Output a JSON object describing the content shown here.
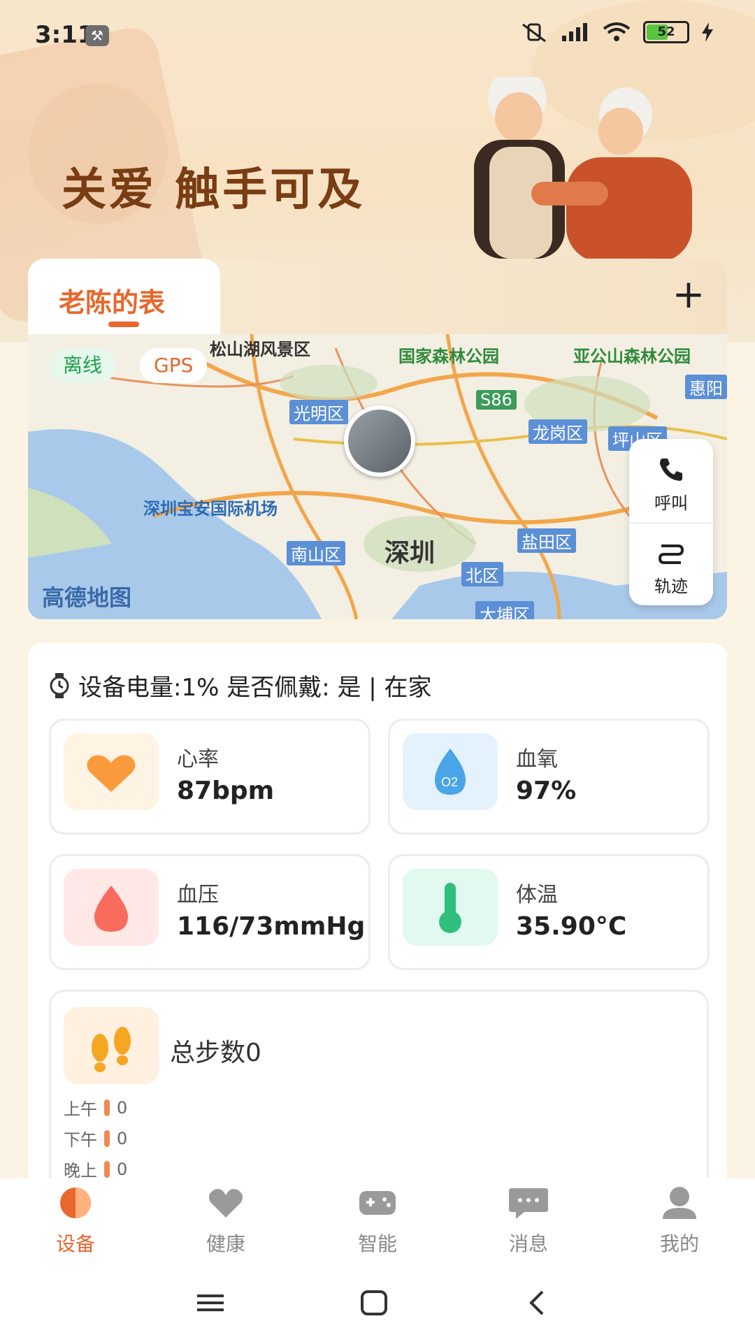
{
  "status_bar": {
    "time": "3:11",
    "battery": "52"
  },
  "banner": {
    "slogan": "关爱 触手可及"
  },
  "tabs": {
    "active_label": "老陈的表",
    "add_symbol": "+"
  },
  "map": {
    "offline_label": "离线",
    "gps_label": "GPS",
    "logo": "高德地图",
    "labels": {
      "guangming": "光明区",
      "longgang": "龙岗区",
      "pingshan": "坪山区",
      "airport": "深圳宝安国际机场",
      "nanshan": "南山区",
      "shenzhen": "深圳",
      "yantian": "盐田区",
      "futian": "北区",
      "forest": "国家森林公园",
      "yagong": "亚公山森林公园",
      "s86": "S86",
      "lake": "松山湖风景区",
      "dapeng": "大埔区",
      "huizhou": "惠阳"
    },
    "call_label": "呼叫",
    "track_label": "轨迹"
  },
  "device": {
    "status_text": "设备电量:1% 是否佩戴: 是 | 在家"
  },
  "metrics": {
    "heart_rate": {
      "name": "心率",
      "value": "87bpm"
    },
    "blood_oxygen": {
      "name": "血氧",
      "value": "97%"
    },
    "blood_pressure": {
      "name": "血压",
      "value": "116/73mmHg"
    },
    "temperature": {
      "name": "体温",
      "value": "35.90°C"
    }
  },
  "steps": {
    "title": "总步数0",
    "rows": [
      {
        "label": "上午",
        "value": "0"
      },
      {
        "label": "下午",
        "value": "0"
      },
      {
        "label": "晚上",
        "value": "0"
      }
    ]
  },
  "nav": [
    {
      "label": "设备",
      "icon": "device-icon"
    },
    {
      "label": "健康",
      "icon": "heart-icon"
    },
    {
      "label": "智能",
      "icon": "gamepad-icon"
    },
    {
      "label": "消息",
      "icon": "message-icon"
    },
    {
      "label": "我的",
      "icon": "profile-icon"
    }
  ],
  "colors": {
    "accent": "#e8672c",
    "offline": "#1aa34a"
  }
}
